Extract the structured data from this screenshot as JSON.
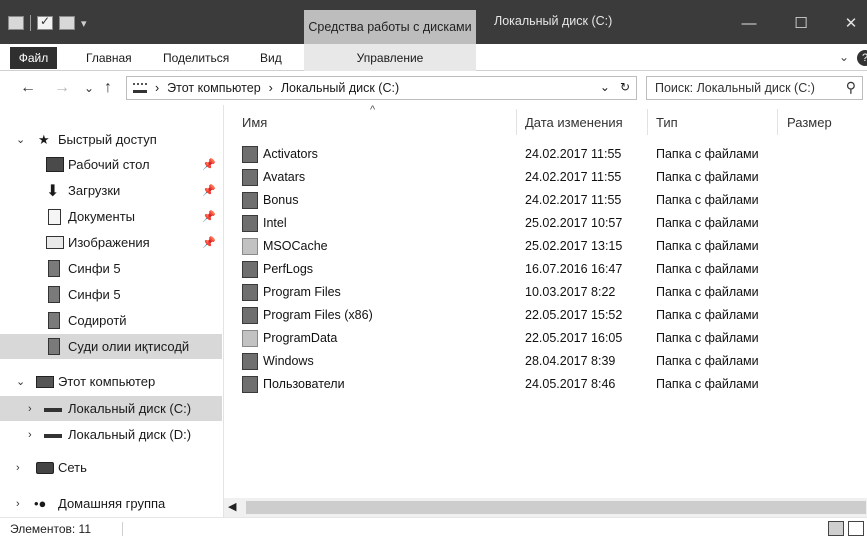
{
  "titlebar": {
    "context_tab": "Средства работы с дисками",
    "window_title": "Локальный диск (C:)",
    "minimize": "—",
    "maximize": "☐",
    "close": "✕"
  },
  "ribbon": {
    "tabs": [
      "Файл",
      "Главная",
      "Поделиться",
      "Вид",
      "Управление"
    ],
    "collapse_glyph": "⌄"
  },
  "navigation": {
    "back": "←",
    "forward": "→",
    "recent": "⌄",
    "up": "↑",
    "separator": "›",
    "breadcrumb": [
      "Этот компьютер",
      "Локальный диск (C:)"
    ],
    "dropdown": "⌄",
    "refresh": "↻"
  },
  "search": {
    "placeholder": "Поиск: Локальный диск (C:)",
    "icon": "search-icon"
  },
  "nav_pane": {
    "quick_access": "Быстрый доступ",
    "quick_items": [
      "Рабочий стол",
      "Загрузки",
      "Документы",
      "Изображения",
      "Синфи 5",
      "Синфи 5",
      "Содиротй",
      "Суди олии иқтисодй"
    ],
    "this_pc": "Этот компьютер",
    "drives": [
      "Локальный диск (C:)",
      "Локальный диск (D:)"
    ],
    "network": "Сеть",
    "homegroup": "Домашняя группа"
  },
  "columns": {
    "name": "Имя",
    "date": "Дата изменения",
    "type": "Тип",
    "size": "Размер"
  },
  "files": [
    {
      "name": "Activators",
      "date": "24.02.2017 11:55",
      "type": "Папка с файлами"
    },
    {
      "name": "Avatars",
      "date": "24.02.2017 11:55",
      "type": "Папка с файлами"
    },
    {
      "name": "Bonus",
      "date": "24.02.2017 11:55",
      "type": "Папка с файлами"
    },
    {
      "name": "Intel",
      "date": "25.02.2017 10:57",
      "type": "Папка с файлами"
    },
    {
      "name": "MSOCache",
      "date": "25.02.2017 13:15",
      "type": "Папка с файлами"
    },
    {
      "name": "PerfLogs",
      "date": "16.07.2016 16:47",
      "type": "Папка с файлами"
    },
    {
      "name": "Program Files",
      "date": "10.03.2017 8:22",
      "type": "Папка с файлами"
    },
    {
      "name": "Program Files (x86)",
      "date": "22.05.2017 15:52",
      "type": "Папка с файлами"
    },
    {
      "name": "ProgramData",
      "date": "22.05.2017 16:05",
      "type": "Папка с файлами"
    },
    {
      "name": "Windows",
      "date": "28.04.2017 8:39",
      "type": "Папка с файлами"
    },
    {
      "name": "Пользователи",
      "date": "24.05.2017 8:46",
      "type": "Папка с файлами"
    }
  ],
  "status": {
    "items_count": "Элементов: 11"
  }
}
